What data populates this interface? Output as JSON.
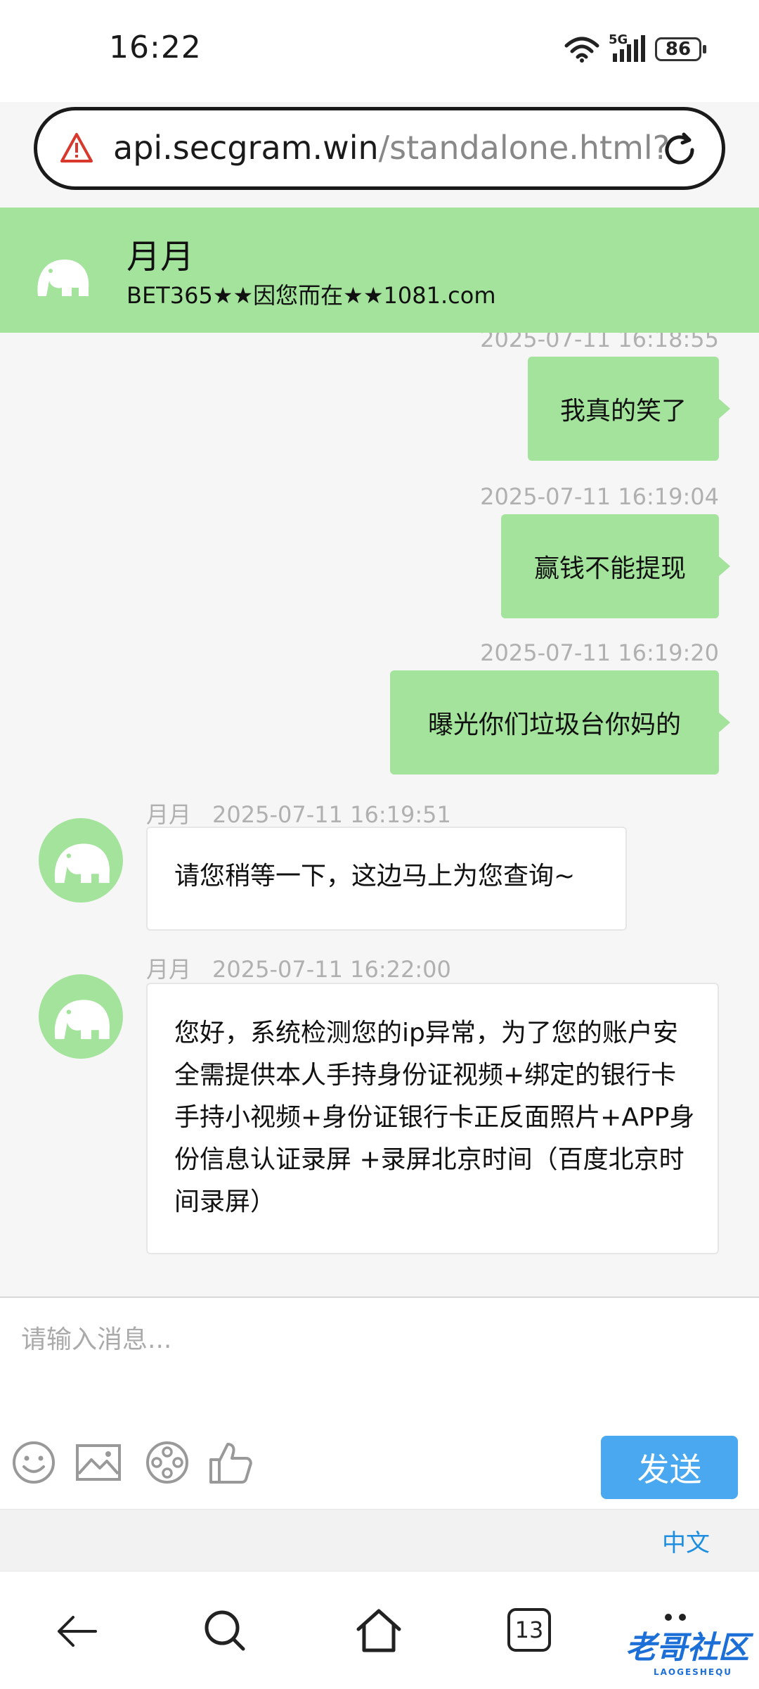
{
  "status_bar": {
    "time": "16:22",
    "network": "5G",
    "battery": "86"
  },
  "browser": {
    "url_host": "api.secgram.win",
    "url_path": "/standalone.html?"
  },
  "chat_header": {
    "name": "月月",
    "subtitle": "BET365★★因您而在★★1081.com"
  },
  "messages": [
    {
      "direction": "out",
      "time": "2025-07-11 16:18:55",
      "text": "我真的笑了"
    },
    {
      "direction": "out",
      "time": "2025-07-11 16:19:04",
      "text": "赢钱不能提现"
    },
    {
      "direction": "out",
      "time": "2025-07-11 16:19:20",
      "text": "曝光你们垃圾台你妈的"
    },
    {
      "direction": "in",
      "sender": "月月",
      "time": "2025-07-11 16:19:51",
      "text": "请您稍等一下，这边马上为您查询~"
    },
    {
      "direction": "in",
      "sender": "月月",
      "time": "2025-07-11 16:22:00",
      "text": "您好，系统检测您的ip异常，为了您的账户安全需提供本人手持身份证视频+绑定的银行卡手持小视频+身份证银行卡正反面照片+APP身份信息认证录屏 +录屏北京时间（百度北京时间录屏）"
    }
  ],
  "composer": {
    "placeholder": "请输入消息...",
    "send_label": "发送",
    "tools": [
      "emoji-icon",
      "image-icon",
      "video-icon",
      "thumbs-up-icon"
    ],
    "language": "中文"
  },
  "nav": {
    "tab_count": "13"
  },
  "watermark": {
    "text": "老哥社区",
    "sub": "LAOGESHEQU"
  },
  "colors": {
    "accent_green": "#a3e39b",
    "send_blue": "#4aa8f0",
    "link_blue": "#1d8ee0"
  }
}
